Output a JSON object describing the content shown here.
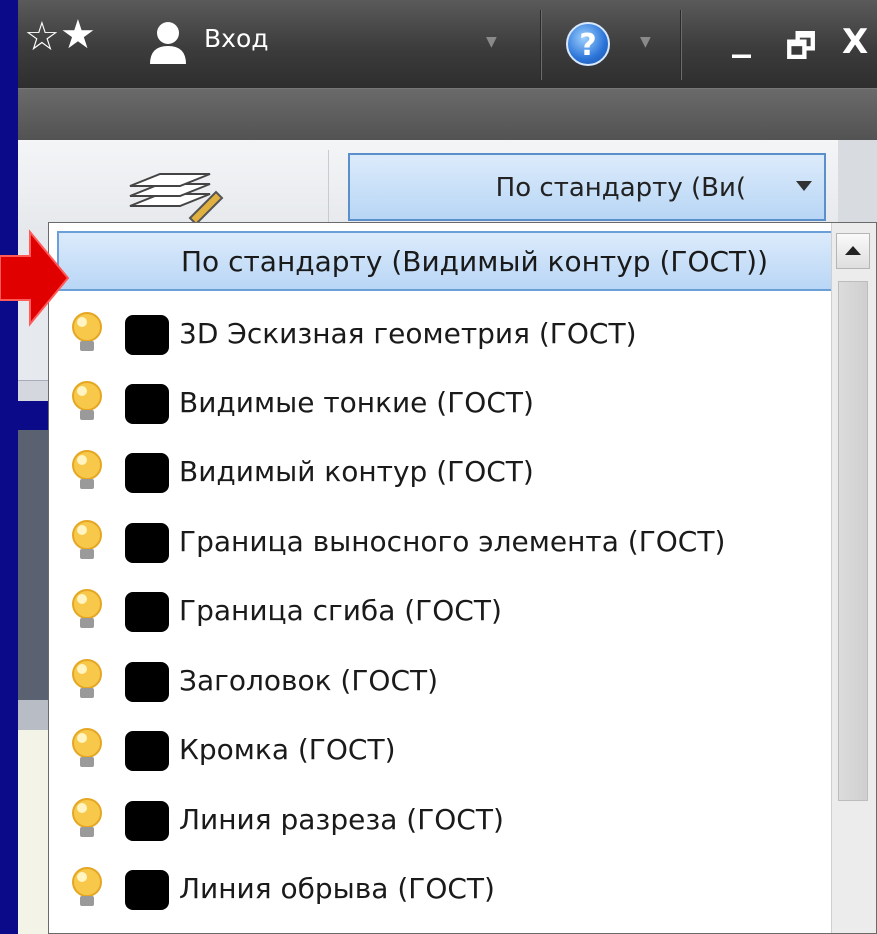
{
  "titlebar": {
    "signin_label": "Вход",
    "help_symbol": "?",
    "minimize_symbol": "_",
    "restore_symbol": "🗗",
    "close_symbol": "X"
  },
  "combo": {
    "value": "По стандарту (Ви("
  },
  "dropdown": {
    "items": [
      {
        "label": "По стандарту (Видимый контур (ГОСТ))",
        "selected": true
      },
      {
        "label": "3D Эскизная геометрия (ГОСТ)"
      },
      {
        "label": "Видимые тонкие (ГОСТ)"
      },
      {
        "label": "Видимый контур (ГОСТ)"
      },
      {
        "label": "Граница выносного элемента (ГОСТ)"
      },
      {
        "label": "Граница сгиба (ГОСТ)"
      },
      {
        "label": "Заголовок (ГОСТ)"
      },
      {
        "label": "Кромка (ГОСТ)"
      },
      {
        "label": "Линия  разреза (ГОСТ)"
      },
      {
        "label": "Линия обрыва (ГОСТ)"
      }
    ]
  },
  "colors": {
    "accent": "#6a9fd8",
    "swatch": "#000000",
    "bulb": "#f5c04a",
    "arrow": "#e00000"
  },
  "icons": {
    "bulb": "lightbulb-icon",
    "swatch": "color-swatch-icon",
    "layers": "layers-icon",
    "star": "star-icon",
    "user": "user-icon",
    "help": "help-icon"
  }
}
